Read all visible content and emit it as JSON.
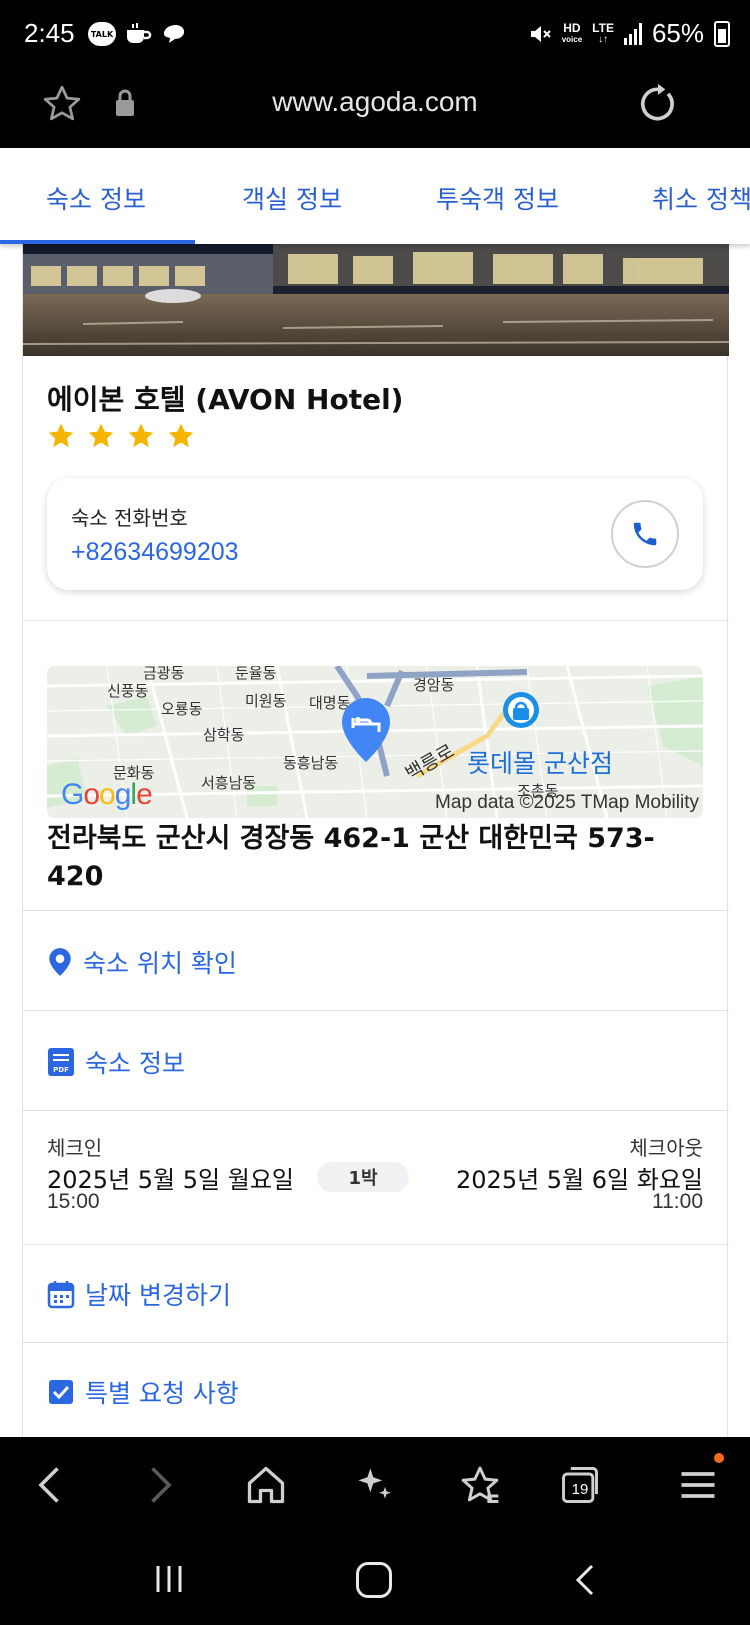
{
  "status_bar": {
    "time": "2:45",
    "apps": [
      "TALK"
    ],
    "hd": "HD",
    "voice": "voice",
    "lte": "LTE",
    "battery": "65%"
  },
  "browser": {
    "url": "www.agoda.com"
  },
  "tabs": [
    {
      "label": "숙소 정보",
      "active": true
    },
    {
      "label": "객실 정보",
      "active": false
    },
    {
      "label": "투숙객 정보",
      "active": false
    },
    {
      "label": "취소 정책",
      "active": false
    }
  ],
  "hotel": {
    "name": "에이본 호텔 (AVON Hotel)",
    "star_rating": 4,
    "phone_label": "숙소 전화번호",
    "phone": "+82634699203",
    "address": "전라북도 군산시 경장동 462-1 군산 대한민국 573-420"
  },
  "map": {
    "labels": [
      "금광동",
      "둔율동",
      "신풍동",
      "경암동",
      "오룡동",
      "미원동",
      "대명동",
      "삼학동",
      "백릉로",
      "문화동",
      "동흥남동",
      "서흥남동",
      "조촌동"
    ],
    "poi": "롯데몰 군산점",
    "google_logo": "Google",
    "attribution": "Map data ©2025 TMap Mobility"
  },
  "links": {
    "location": "숙소 위치 확인",
    "info": "숙소 정보",
    "change_date": "날짜 변경하기",
    "special_request": "특별 요청 사항"
  },
  "stay": {
    "checkin_label": "체크인",
    "checkin_date": "2025년 5월 5일 월요일",
    "checkin_time": "15:00",
    "nights": "1박",
    "checkout_label": "체크아웃",
    "checkout_date": "2025년 5월 6일 화요일",
    "checkout_time": "11:00"
  },
  "toolbar": {
    "tab_count": "19"
  },
  "colors": {
    "accent": "#2a67e0",
    "star": "#f4b400",
    "pin": "#4285f4",
    "notification": "#ff6a1a"
  }
}
